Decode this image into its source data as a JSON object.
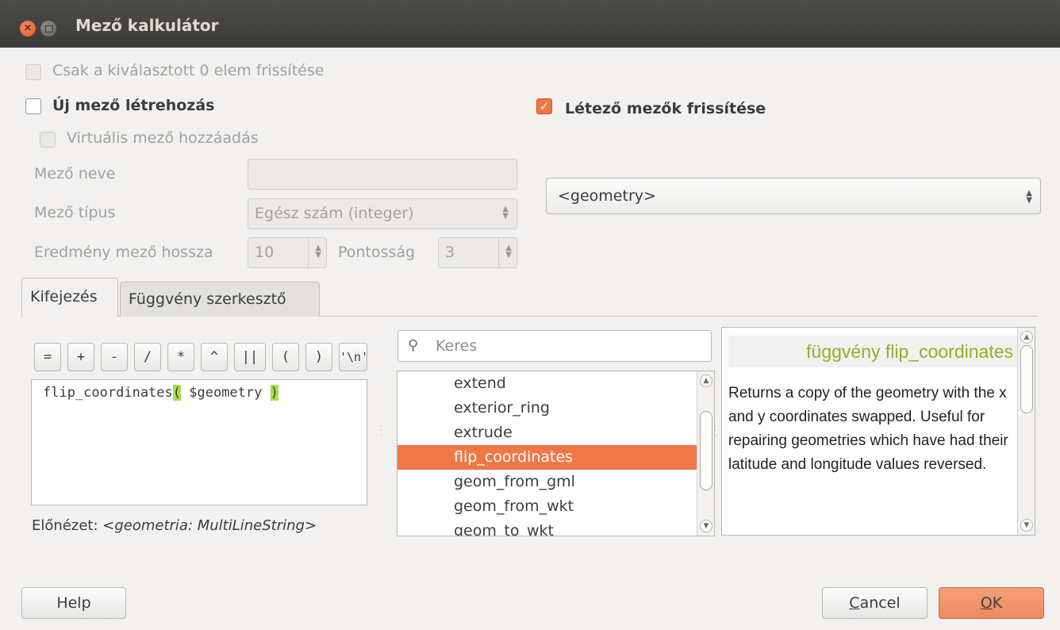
{
  "window": {
    "title": "Mező kalkulátor",
    "close_glyph": "×"
  },
  "options": {
    "only_selected": "Csak a kiválasztott 0 elem frissítése",
    "create_new": "Új mező létrehozás",
    "update_existing": "Létező mezők frissítése",
    "virtual_field": "Virtuális mező hozzáadás"
  },
  "new_field": {
    "name_label": "Mező neve",
    "name_value": "",
    "type_label": "Mező típus",
    "type_value": "Egész szám (integer)",
    "length_label": "Eredmény mező hossza",
    "length_value": "10",
    "precision_label": "Pontosság",
    "precision_value": "3"
  },
  "existing_field": {
    "selected": "<geometry>"
  },
  "tabs": [
    {
      "label": "Kifejezés"
    },
    {
      "label": "Függvény szerkesztő"
    }
  ],
  "operators": [
    "=",
    "+",
    "-",
    "/",
    "*",
    "^",
    "||",
    "(",
    ")",
    "'\\n'"
  ],
  "expression": {
    "prefix": "flip_coordinates",
    "open_paren": "(",
    "arg": " $geometry ",
    "close_paren": ")"
  },
  "preview": {
    "label": "Előnézet: ",
    "value": "<geometria: MultiLineString>"
  },
  "search": {
    "placeholder": "Keres",
    "icon": "search-icon"
  },
  "function_list": {
    "items": [
      "extend",
      "exterior_ring",
      "extrude",
      "flip_coordinates",
      "geom_from_gml",
      "geom_from_wkt",
      "geom_to_wkt"
    ],
    "selected_index": 3
  },
  "help": {
    "title": "függvény flip_coordinates",
    "text": "Returns a copy of the geometry with the x and y coordinates swapped. Useful for repairing geometries which have had their latitude and longitude values reversed."
  },
  "buttons": {
    "help": "Help",
    "cancel_underlined": "C",
    "cancel_rest": "ancel",
    "ok_underlined": "O",
    "ok_rest": "K"
  },
  "colors": {
    "accent": "#f07746",
    "highlight": "#a8e04a",
    "help_title": "#93b023"
  }
}
